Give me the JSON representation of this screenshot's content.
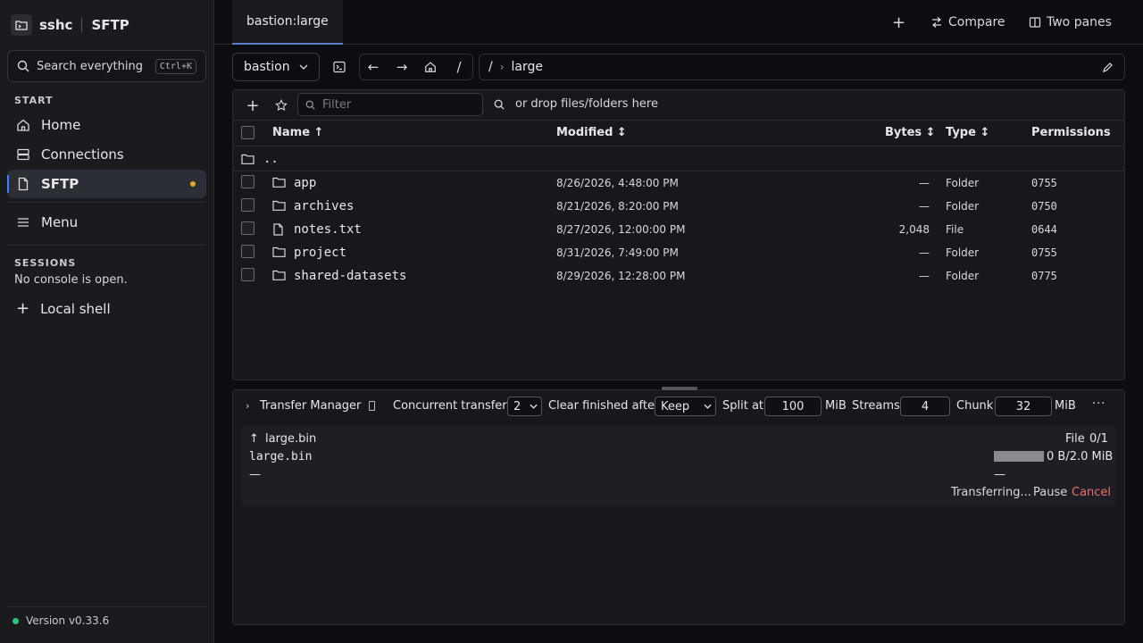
{
  "app": {
    "name": "sshc",
    "section": "SFTP"
  },
  "sidebar": {
    "search": {
      "placeholder": "Search everything",
      "shortcut": "Ctrl+K"
    },
    "start_label": "START",
    "items": [
      {
        "label": "Home",
        "icon": "home-icon"
      },
      {
        "label": "Connections",
        "icon": "server-icon"
      },
      {
        "label": "SFTP",
        "icon": "file-icon",
        "active": true
      }
    ],
    "menu_label": "Menu",
    "sessions_label": "SESSIONS",
    "sessions_empty": "No console is open.",
    "local_shell": "Local shell",
    "version": "Version v0.33.6"
  },
  "tabs": [
    {
      "label": "bastion:large"
    }
  ],
  "toolbar": {
    "add": "+",
    "compare": "Compare",
    "two_panes": "Two panes"
  },
  "pathbar": {
    "host": "bastion",
    "root": "/",
    "crumb_sep": "/",
    "crumb": "large"
  },
  "files": {
    "filter_placeholder": "Filter",
    "drop_hint": "or drop files/folders here",
    "columns": {
      "name": "Name ↑",
      "modified": "Modified ↕",
      "bytes": "Bytes ↕",
      "type": "Type ↕",
      "permissions": "Permissions"
    },
    "parent": "..",
    "rows": [
      {
        "name": "app",
        "modified": "8/26/2026, 4:48:00 PM",
        "bytes": "—",
        "type": "Folder",
        "perm": "0755",
        "kind": "folder"
      },
      {
        "name": "archives",
        "modified": "8/21/2026, 8:20:00 PM",
        "bytes": "—",
        "type": "Folder",
        "perm": "0750",
        "kind": "folder"
      },
      {
        "name": "notes.txt",
        "modified": "8/27/2026, 12:00:00 PM",
        "bytes": "2,048",
        "type": "File",
        "perm": "0644",
        "kind": "file"
      },
      {
        "name": "project",
        "modified": "8/31/2026, 7:49:00 PM",
        "bytes": "—",
        "type": "Folder",
        "perm": "0755",
        "kind": "folder"
      },
      {
        "name": "shared-datasets",
        "modified": "8/29/2026, 12:28:00 PM",
        "bytes": "—",
        "type": "Folder",
        "perm": "0775",
        "kind": "folder"
      }
    ]
  },
  "transfer": {
    "title": "Transfer Manager",
    "concurrent_label": "Concurrent transfers",
    "concurrent_value": "2",
    "clear_label": "Clear finished after",
    "clear_value": "Keep",
    "split_label": "Split at",
    "split_value": "100",
    "split_unit": "MiB",
    "streams_label": "Streams",
    "streams_value": "4",
    "chunk_label": "Chunk",
    "chunk_value": "32",
    "chunk_unit": "MiB",
    "job": {
      "direction": "↑",
      "name": "large.bin",
      "file_label": "File",
      "file_count": "0/1",
      "item_name": "large.bin",
      "progress_text": "0 B/2.0 MiB",
      "progress_fraction": 0,
      "dash_left": "—",
      "dash_right": "—",
      "status": "Transferring...",
      "pause": "Pause",
      "cancel": "Cancel"
    }
  },
  "colors": {
    "accent": "#4b7cff",
    "cancel": "#f26b6b",
    "unsaved_dot": "#e0a52c",
    "online": "#2fc27a"
  }
}
